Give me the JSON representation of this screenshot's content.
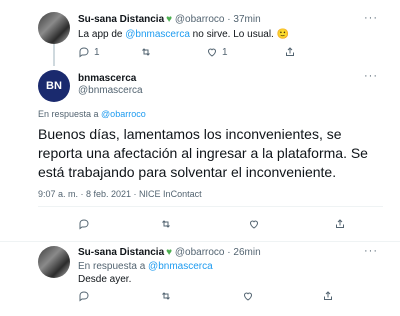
{
  "tweet1": {
    "name": "Su-sana Distancia",
    "verified_icon": "green-heart",
    "handle": "@obarroco",
    "time": "37min",
    "text_prefix": "La app de ",
    "mention": "@bnmascerca",
    "text_suffix": " no sirve. Lo usual.",
    "emoji": "🙂",
    "reply_count": "1",
    "like_count": "1"
  },
  "tweet2": {
    "name": "bnmascerca",
    "handle": "@bnmascerca",
    "avatar_text": "BN",
    "reply_prefix": "En respuesta a ",
    "reply_mention": "@obarroco",
    "text": "Buenos días, lamentamos los inconvenientes, se reporta una afectación al ingresar a la plataforma. Se está trabajando para solventar el inconveniente.",
    "meta": "9:07 a. m. · 8 feb. 2021 · NICE InContact"
  },
  "tweet3": {
    "name": "Su-sana Distancia",
    "verified_icon": "green-heart",
    "handle": "@obarroco",
    "time": "26min",
    "reply_prefix": "En respuesta a ",
    "reply_mention": "@bnmascerca",
    "text": "Desde ayer."
  },
  "more_label": "···",
  "colors": {
    "link": "#1d9bf0",
    "muted": "#536471",
    "heart": "#4caf50"
  }
}
